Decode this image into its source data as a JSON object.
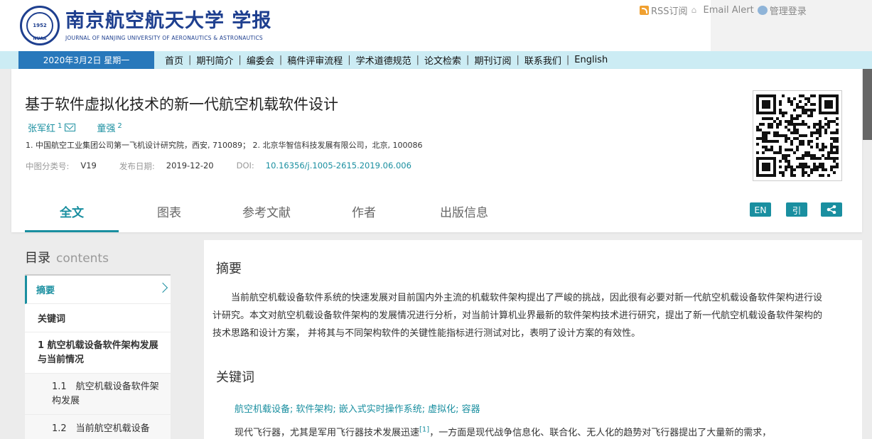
{
  "header": {
    "brand_cn": "南京航空航天大学 学报",
    "brand_en": "JOURNAL OF NANJING UNIVERSITY OF AERONAUTICS & ASTRONAUTICS",
    "seal_top": "南京航空航天大学",
    "seal_year": "1952",
    "seal_bottom": "NUAA",
    "links": {
      "rss": "RSS订阅",
      "email_alert": "Email Alert",
      "admin": "管理登录"
    }
  },
  "nav": {
    "date": "2020年3月2日 星期一",
    "items": [
      "首页",
      "期刊简介",
      "编委会",
      "稿件评审流程",
      "学术道德规范",
      "论文检索",
      "期刊订阅",
      "联系我们",
      "English"
    ]
  },
  "article": {
    "title": "基于软件虚拟化技术的新一代航空机载软件设计",
    "authors": [
      {
        "name": "张军红",
        "sup": "1"
      },
      {
        "name": "童强",
        "sup": "2"
      }
    ],
    "affiliations": "1. 中国航空工业集团公司第一飞机设计研究院，西安, 710089； 2. 北京华智信科技发展有限公司，北京, 100086",
    "meta": {
      "clc_label": "中图分类号:",
      "clc_value": "V19",
      "date_label": "发布日期:",
      "date_value": "2019-12-20",
      "doi_label": "DOI:",
      "doi_value": "10.16356/j.1005-2615.2019.06.006"
    }
  },
  "tabs": [
    "全文",
    "图表",
    "参考文献",
    "作者",
    "出版信息"
  ],
  "tools": {
    "en": "EN",
    "cite": "引"
  },
  "toc": {
    "title": "目录",
    "title_en": "contents",
    "items": [
      {
        "label": "摘要"
      },
      {
        "label": "关键词"
      },
      {
        "label": "1 航空机载设备软件架构发展与当前情况"
      },
      {
        "label": "1.1　航空机载设备软件架构发展"
      },
      {
        "label": "1.2　当前航空机载设备"
      }
    ]
  },
  "content": {
    "abstract_heading": "摘要",
    "abstract_text": "当前航空机载设备软件系统的快速发展对目前国内外主流的机载软件架构提出了严峻的挑战，因此很有必要对新一代航空机载设备软件架构进行设计研究。本文对航空机载设备软件架构的发展情况进行分析，对当前计算机业界最新的软件架构技术进行研究，提出了新一代航空机载设备软件架构的技术思路和设计方案， 并将其与不同架构软件的关键性能指标进行测试对比，表明了设计方案的有效性。",
    "keywords_heading": "关键词",
    "keywords": [
      "航空机载设备;",
      "软件架构;",
      "嵌入式实时操作系统;",
      "虚拟化;",
      "容器"
    ],
    "body_start": "现代飞行器，尤其是军用飞行器技术发展迅速",
    "body_cite": "[1]",
    "body_rest": "，一方面是现代战争信息化、联合化、无人化的趋势对飞行器提出了大量新的需求，"
  },
  "colors": {
    "accent": "#1a8fa0",
    "nav_bg": "#ccecf4",
    "date_bg": "#2878bb",
    "brand": "#1e3f8f"
  }
}
